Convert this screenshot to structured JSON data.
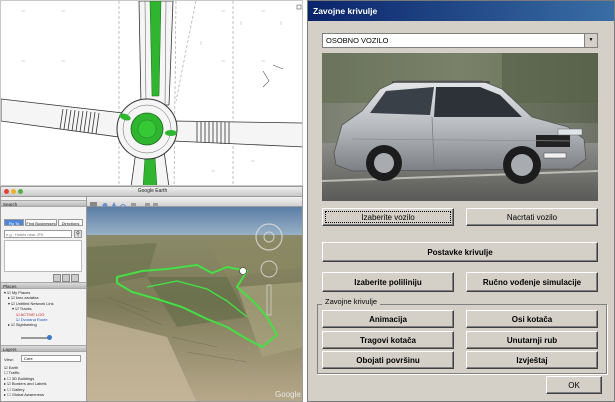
{
  "google_earth": {
    "window_title": "Google Earth",
    "search": {
      "header": "Search",
      "tabs": [
        "Fly To",
        "Find Businesses",
        "Directions"
      ],
      "placeholder": "e.g., Hotels near JFK"
    },
    "places": {
      "header": "Places",
      "items": [
        "My Places",
        "kmz.zadatna",
        "Untitled Network Link",
        "Tracks",
        "ACTIVE LOG",
        "Dvorana Route",
        "Sightseeing"
      ]
    },
    "layers": {
      "header": "Layers",
      "view_label": "View:",
      "view_value": "Core",
      "items": [
        "Earth",
        "Traffic",
        "3D Buildings",
        "Borders and Labels",
        "Gallery",
        "Global Awareness"
      ]
    },
    "map_watermark": "Google"
  },
  "dialog": {
    "title": "Zavojne krivulje",
    "vehicle_select": "OSOBNO VOZILO",
    "buttons": {
      "choose_vehicle": "Izaberite vozilo",
      "draw_vehicle": "Nacrtati vozilo",
      "curve_settings": "Postavke krivulje",
      "choose_polyline": "Izaberite poliliniju",
      "manual_simulation": "Ručno vođenje simulacije",
      "animation": "Animacija",
      "wheel_axles": "Osi kotača",
      "wheel_tracks": "Tragovi kotača",
      "inner_edge": "Unutarnji rub",
      "color_surface": "Obojati površinu",
      "report": "Izvještaj",
      "ok": "OK"
    },
    "group_label": "Zavojne krivulje",
    "colors": {
      "titlebar": "#0a246a",
      "face": "#d4d0c8"
    }
  }
}
